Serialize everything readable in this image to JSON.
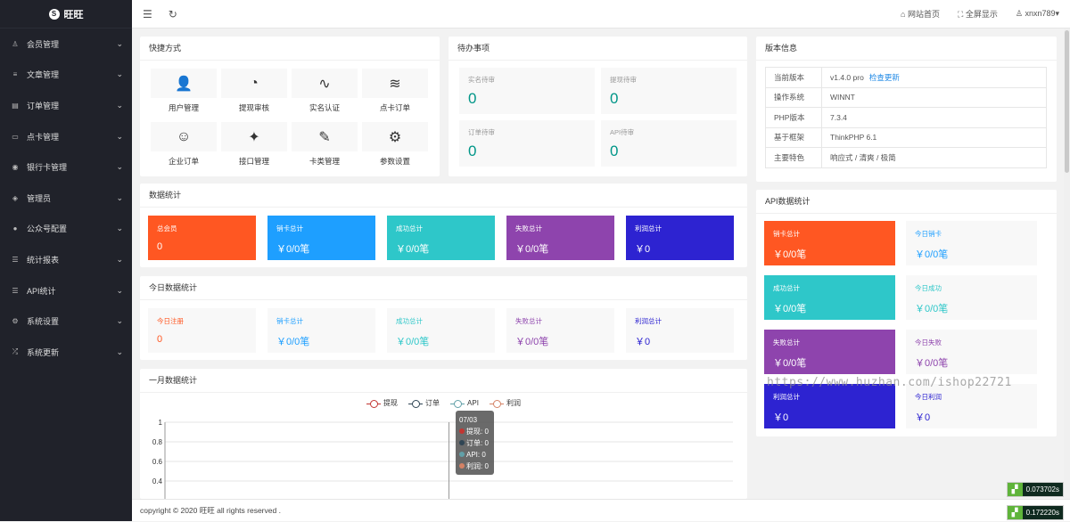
{
  "brand": {
    "logo_glyph": "S",
    "name": "旺旺"
  },
  "sidebar": {
    "items": [
      {
        "icon": "user-icon",
        "glyph": "♙",
        "label": "会员管理"
      },
      {
        "icon": "article-icon",
        "glyph": "≡",
        "label": "文章管理"
      },
      {
        "icon": "order-icon",
        "glyph": "▤",
        "label": "订单管理"
      },
      {
        "icon": "card-icon",
        "glyph": "▭",
        "label": "点卡管理"
      },
      {
        "icon": "bank-icon",
        "glyph": "◉",
        "label": "银行卡管理"
      },
      {
        "icon": "shield-icon",
        "glyph": "◈",
        "label": "管理员"
      },
      {
        "icon": "wechat-icon",
        "glyph": "●",
        "label": "公众号配置"
      },
      {
        "icon": "report-icon",
        "glyph": "☰",
        "label": "统计报表"
      },
      {
        "icon": "api-icon",
        "glyph": "☰",
        "label": "API统计"
      },
      {
        "icon": "settings-icon",
        "glyph": "⚙",
        "label": "系统设置"
      },
      {
        "icon": "update-icon",
        "glyph": "⤮",
        "label": "系统更新"
      }
    ],
    "chevron": "⌄"
  },
  "topbar": {
    "menu_glyph": "☰",
    "refresh_glyph": "↻",
    "home": "网站首页",
    "home_glyph": "⌂",
    "fullscreen": "全屏显示",
    "fullscreen_glyph": "⛶",
    "user": "xnxn789",
    "user_glyph": "♙",
    "user_caret": "▾"
  },
  "quick": {
    "title": "快捷方式",
    "items": [
      {
        "icon": "users-icon",
        "glyph": "👤",
        "label": "用户管理"
      },
      {
        "icon": "gauge-icon",
        "glyph": "◔",
        "label": "提现审核"
      },
      {
        "icon": "pulse-icon",
        "glyph": "∿",
        "label": "实名认证"
      },
      {
        "icon": "layers-icon",
        "glyph": "≋",
        "label": "点卡订单"
      },
      {
        "icon": "smile-icon",
        "glyph": "☺",
        "label": "企业订单"
      },
      {
        "icon": "compass-icon",
        "glyph": "✦",
        "label": "接口管理"
      },
      {
        "icon": "edit-icon",
        "glyph": "✎",
        "label": "卡类管理"
      },
      {
        "icon": "gear-icon",
        "glyph": "⚙",
        "label": "参数设置"
      }
    ]
  },
  "todo": {
    "title": "待办事项",
    "items": [
      {
        "label": "实名待审",
        "value": "0"
      },
      {
        "label": "提现待审",
        "value": "0"
      },
      {
        "label": "订单待审",
        "value": "0"
      },
      {
        "label": "API待审",
        "value": "0"
      }
    ]
  },
  "version": {
    "title": "版本信息",
    "rows": [
      {
        "k": "当前版本",
        "v": "v1.4.0 pro",
        "link": "检查更新"
      },
      {
        "k": "操作系统",
        "v": "WINNT",
        "link": ""
      },
      {
        "k": "PHP版本",
        "v": "7.3.4",
        "link": ""
      },
      {
        "k": "基于框架",
        "v": "ThinkPHP 6.1",
        "link": ""
      },
      {
        "k": "主要特色",
        "v": "响应式 / 清爽 / 极简",
        "link": ""
      }
    ]
  },
  "stats": {
    "title": "数据统计",
    "items": [
      {
        "label": "总会员",
        "value": "0",
        "color": "#ff5722"
      },
      {
        "label": "销卡总计",
        "value": "￥0/0笔",
        "color": "#1e9fff"
      },
      {
        "label": "成功总计",
        "value": "￥0/0笔",
        "color": "#2ec7c9"
      },
      {
        "label": "失败总计",
        "value": "￥0/0笔",
        "color": "#8e44ad"
      },
      {
        "label": "利润总计",
        "value": "￥0",
        "color": "#2d23d1"
      }
    ]
  },
  "today": {
    "title": "今日数据统计",
    "items": [
      {
        "label": "今日注册",
        "value": "0",
        "color": "#ff5722"
      },
      {
        "label": "销卡总计",
        "value": "￥0/0笔",
        "color": "#1e9fff"
      },
      {
        "label": "成功总计",
        "value": "￥0/0笔",
        "color": "#2ec7c9"
      },
      {
        "label": "失败总计",
        "value": "￥0/0笔",
        "color": "#8e44ad"
      },
      {
        "label": "利润总计",
        "value": "￥0",
        "color": "#2d23d1"
      }
    ]
  },
  "api": {
    "title": "API数据统计",
    "items": [
      {
        "label": "销卡总计",
        "value": "￥0/0笔",
        "color": "#ff5722",
        "filled": true
      },
      {
        "label": "今日销卡",
        "value": "￥0/0笔",
        "color": "#1e9fff",
        "filled": false
      },
      {
        "label": "成功总计",
        "value": "￥0/0笔",
        "color": "#2ec7c9",
        "filled": true
      },
      {
        "label": "今日成功",
        "value": "￥0/0笔",
        "color": "#2ec7c9",
        "filled": false
      },
      {
        "label": "失败总计",
        "value": "￥0/0笔",
        "color": "#8e44ad",
        "filled": true
      },
      {
        "label": "今日失败",
        "value": "￥0/0笔",
        "color": "#8e44ad",
        "filled": false
      },
      {
        "label": "利润总计",
        "value": "￥0",
        "color": "#2d23d1",
        "filled": true
      },
      {
        "label": "今日利润",
        "value": "￥0",
        "color": "#2d23d1",
        "filled": false
      }
    ]
  },
  "month": {
    "title": "一月数据统计"
  },
  "chart_data": {
    "type": "line",
    "title": "",
    "series": [
      {
        "name": "提现",
        "color": "#c23531",
        "values": [
          0
        ]
      },
      {
        "name": "订单",
        "color": "#2f4554",
        "values": [
          0
        ]
      },
      {
        "name": "API",
        "color": "#61a0a8",
        "values": [
          0
        ]
      },
      {
        "name": "利润",
        "color": "#d48265",
        "values": [
          0
        ]
      }
    ],
    "x": [
      "07/03"
    ],
    "yticks": [
      "1",
      "0.8",
      "0.6",
      "0.4"
    ],
    "ylim": [
      0,
      1
    ],
    "grid": true,
    "legend": "top-center",
    "tooltip": {
      "title": "07/03",
      "rows": [
        {
          "name": "提现",
          "value": "0"
        },
        {
          "name": "订单",
          "value": "0"
        },
        {
          "name": "API",
          "value": "0"
        },
        {
          "name": "利润",
          "value": "0"
        }
      ]
    }
  },
  "footer": {
    "prefix": "copyright © 2020 ",
    "brand": "旺旺",
    "suffix": " all rights reserved ."
  },
  "timers": [
    "0.073702s",
    "0.172220s"
  ],
  "watermark": "https://www.huzhan.com/ishop22721"
}
